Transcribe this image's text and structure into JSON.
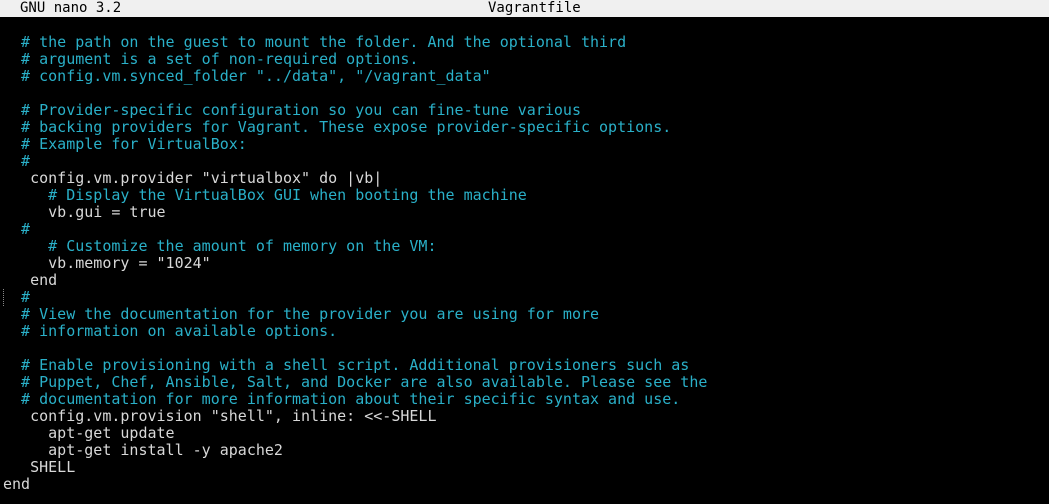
{
  "titlebar": {
    "app_name": "GNU nano 3.2",
    "file_name": "Vagrantfile"
  },
  "editor": {
    "lines": [
      {
        "text": "  # the path on the guest to mount the folder. And the optional third",
        "kind": "comment"
      },
      {
        "text": "  # argument is a set of non-required options.",
        "kind": "comment"
      },
      {
        "text": "  # config.vm.synced_folder \"../data\", \"/vagrant_data\"",
        "kind": "comment"
      },
      {
        "text": "",
        "kind": "blank"
      },
      {
        "text": "  # Provider-specific configuration so you can fine-tune various",
        "kind": "comment"
      },
      {
        "text": "  # backing providers for Vagrant. These expose provider-specific options.",
        "kind": "comment"
      },
      {
        "text": "  # Example for VirtualBox:",
        "kind": "comment"
      },
      {
        "text": "  #",
        "kind": "comment"
      },
      {
        "text": "   config.vm.provider \"virtualbox\" do |vb|",
        "kind": "code"
      },
      {
        "text": "     # Display the VirtualBox GUI when booting the machine",
        "kind": "comment"
      },
      {
        "text": "     vb.gui = true",
        "kind": "code"
      },
      {
        "text": "  #",
        "kind": "comment"
      },
      {
        "text": "     # Customize the amount of memory on the VM:",
        "kind": "comment"
      },
      {
        "text": "     vb.memory = \"1024\"",
        "kind": "code"
      },
      {
        "text": "   end",
        "kind": "code"
      },
      {
        "text": "  #",
        "kind": "comment"
      },
      {
        "text": "  # View the documentation for the provider you are using for more",
        "kind": "comment"
      },
      {
        "text": "  # information on available options.",
        "kind": "comment"
      },
      {
        "text": "",
        "kind": "blank"
      },
      {
        "text": "  # Enable provisioning with a shell script. Additional provisioners such as",
        "kind": "comment"
      },
      {
        "text": "  # Puppet, Chef, Ansible, Salt, and Docker are also available. Please see the",
        "kind": "comment"
      },
      {
        "text": "  # documentation for more information about their specific syntax and use.",
        "kind": "comment"
      },
      {
        "text": "   config.vm.provision \"shell\", inline: <<-SHELL",
        "kind": "code"
      },
      {
        "text": "     apt-get update",
        "kind": "code"
      },
      {
        "text": "     apt-get install -y apache2",
        "kind": "code"
      },
      {
        "text": "   SHELL",
        "kind": "code"
      },
      {
        "text": "end",
        "kind": "code"
      }
    ]
  },
  "colors": {
    "background": "#000000",
    "titlebar_bg": "#f0f0f0",
    "titlebar_text": "#000000",
    "comment": "#2ab0c8",
    "code": "#d8d8d8"
  }
}
